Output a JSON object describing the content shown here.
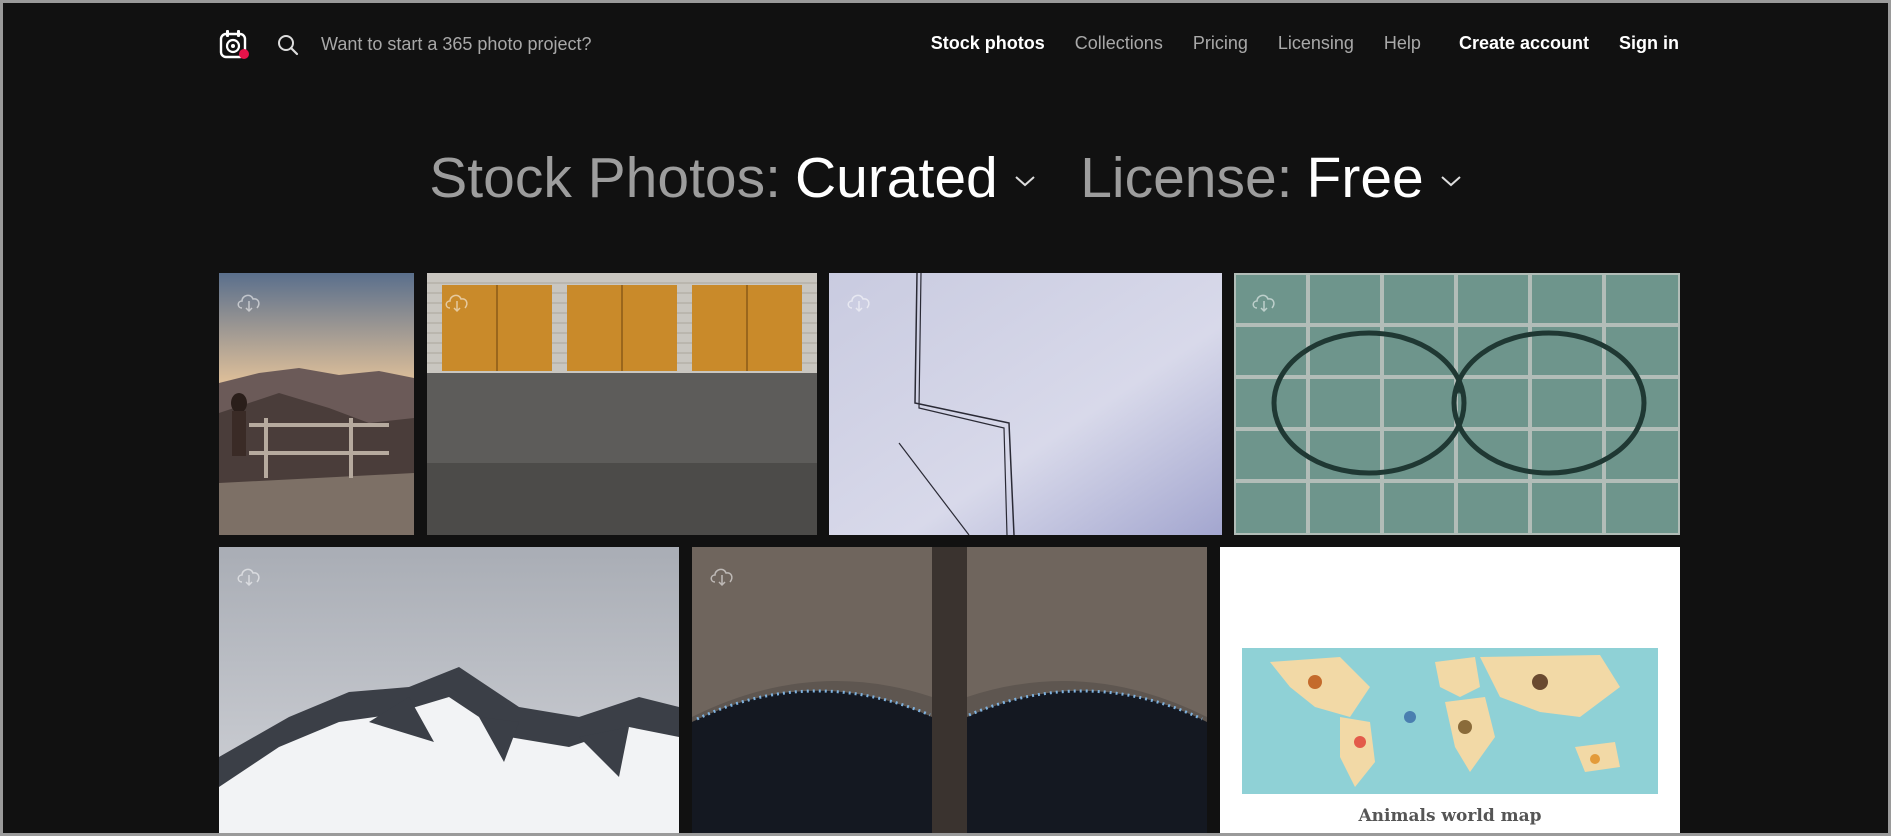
{
  "header": {
    "search_placeholder": "Want to start a 365 photo project?",
    "nav": [
      {
        "label": "Stock photos",
        "active": true
      },
      {
        "label": "Collections"
      },
      {
        "label": "Pricing"
      },
      {
        "label": "Licensing"
      },
      {
        "label": "Help"
      },
      {
        "label": "Create account"
      },
      {
        "label": "Sign in"
      }
    ]
  },
  "filters": {
    "stock": {
      "label": "Stock Photos:",
      "value": "Curated"
    },
    "license": {
      "label": "License:",
      "value": "Free"
    }
  },
  "photos": [
    {
      "subject": "woman on mountain overlook at sunset"
    },
    {
      "subject": "three wooden garage doors"
    },
    {
      "subject": "wires against cloudy sky"
    },
    {
      "subject": "glasses on glass block wall"
    },
    {
      "subject": "snowy mountain peak"
    },
    {
      "subject": "tunnel arches with lights"
    },
    {
      "subject": "animals world map",
      "caption": "Animals world map"
    }
  ],
  "colors": {
    "background": "#111111",
    "nav_active": "#ffffff",
    "nav_default": "#a9a9a9",
    "logo_dot": "#e8134a"
  }
}
